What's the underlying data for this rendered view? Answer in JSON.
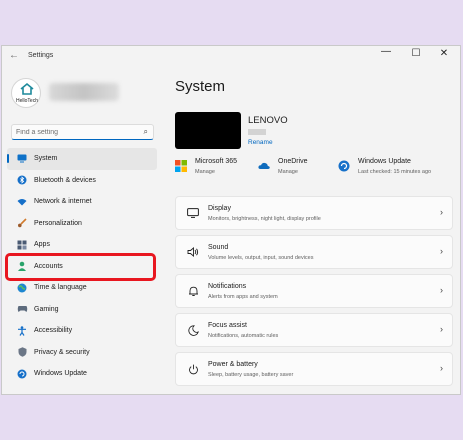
{
  "window": {
    "title": "Settings"
  },
  "profile": {
    "avatar_text": "HelloTech"
  },
  "search": {
    "placeholder": "Find a setting"
  },
  "sidebar": {
    "items": [
      {
        "label": "System",
        "icon": "monitor-icon",
        "active": true
      },
      {
        "label": "Bluetooth & devices",
        "icon": "bluetooth-icon"
      },
      {
        "label": "Network & internet",
        "icon": "wifi-icon"
      },
      {
        "label": "Personalization",
        "icon": "brush-icon"
      },
      {
        "label": "Apps",
        "icon": "apps-icon"
      },
      {
        "label": "Accounts",
        "icon": "person-icon"
      },
      {
        "label": "Time & language",
        "icon": "globe-icon"
      },
      {
        "label": "Gaming",
        "icon": "gamepad-icon"
      },
      {
        "label": "Accessibility",
        "icon": "accessibility-icon"
      },
      {
        "label": "Privacy & security",
        "icon": "shield-icon"
      },
      {
        "label": "Windows Update",
        "icon": "update-icon"
      }
    ]
  },
  "main": {
    "title": "System",
    "device": {
      "name": "LENOVO",
      "rename_label": "Rename"
    },
    "quick": [
      {
        "title": "Microsoft 365",
        "subtitle": "Manage",
        "icon": "microsoft-365-icon"
      },
      {
        "title": "OneDrive",
        "subtitle": "Manage",
        "icon": "onedrive-icon"
      },
      {
        "title": "Windows Update",
        "subtitle": "Last checked: 15 minutes ago",
        "icon": "windows-update-icon"
      }
    ],
    "cards": [
      {
        "title": "Display",
        "subtitle": "Monitors, brightness, night light, display profile",
        "icon": "display-icon"
      },
      {
        "title": "Sound",
        "subtitle": "Volume levels, output, input, sound devices",
        "icon": "speaker-icon"
      },
      {
        "title": "Notifications",
        "subtitle": "Alerts from apps and system",
        "icon": "bell-icon"
      },
      {
        "title": "Focus assist",
        "subtitle": "Notifications, automatic rules",
        "icon": "moon-icon"
      },
      {
        "title": "Power & battery",
        "subtitle": "Sleep, battery usage, battery saver",
        "icon": "power-icon"
      }
    ]
  },
  "colors": {
    "accent": "#0067c0",
    "highlight": "#e8161f",
    "background": "#e6dcf2"
  }
}
